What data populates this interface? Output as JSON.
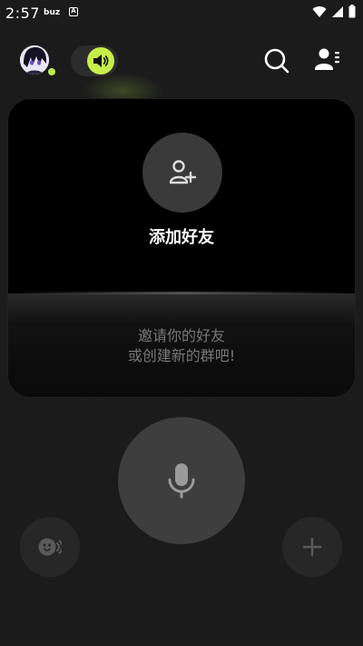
{
  "status_bar": {
    "time": "2:57",
    "notification_app": "buz",
    "notification_icon_letter": "A"
  },
  "header": {
    "sound_toggle_state": "on",
    "online_status_color": "#b5ee4a",
    "accent_color": "#c5ee49"
  },
  "card": {
    "add_friend_label": "添加好友",
    "invite_line1": "邀请你的好友",
    "invite_line2": "或创建新的群吧!"
  },
  "icons": {
    "search": "search-icon",
    "contacts": "contacts-icon",
    "add_person": "add-person-icon",
    "microphone": "microphone-icon",
    "voice_filter": "voice-filter-icon",
    "plus": "plus-icon"
  }
}
